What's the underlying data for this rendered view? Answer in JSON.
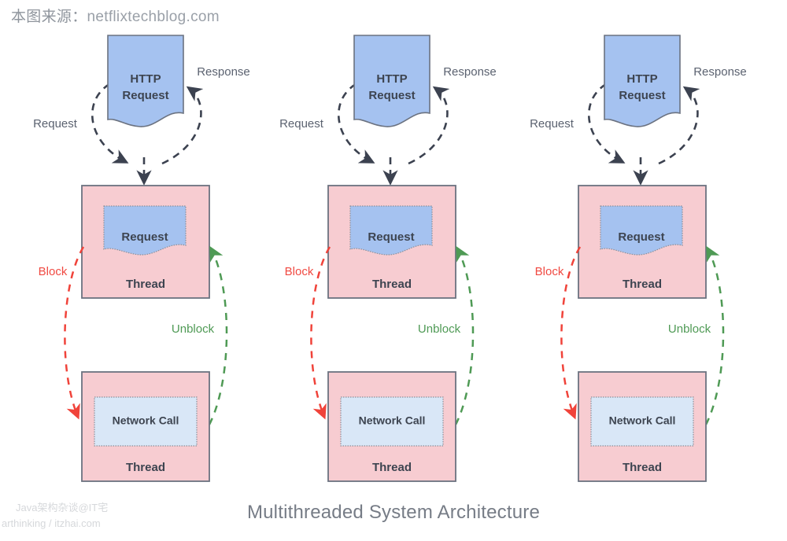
{
  "source_credit": {
    "label": "本图来源：",
    "url": "netflixtechblog.com"
  },
  "diagram": {
    "title": "Multithreaded System Architecture",
    "type": "architecture-flow",
    "column_count": 3,
    "colors": {
      "http_request_fill": "#a5c2f0",
      "thread_fill": "#f7ccd1",
      "request_fill": "#a5c2f0",
      "network_call_fill": "#d9e7f7",
      "shape_stroke": "#6b7280",
      "text": "#3d4450",
      "edge_label": "#5b6270",
      "block": "#f04a42",
      "unblock": "#4f9a55",
      "arrow": "#3c4250",
      "title": "#767c86",
      "watermark": "#d6d8db",
      "credit": "#9aa0a8"
    },
    "columns": [
      {
        "id": "column-1",
        "http_request_label_line1": "HTTP",
        "http_request_label_line2": "Request",
        "request_in_label": "Request",
        "response_out_label": "Response",
        "thread_top_label": "Thread",
        "request_box_label": "Request",
        "block_label": "Block",
        "unblock_label": "Unblock",
        "thread_bottom_label": "Thread",
        "network_call_label": "Network Call"
      },
      {
        "id": "column-2",
        "http_request_label_line1": "HTTP",
        "http_request_label_line2": "Request",
        "request_in_label": "Request",
        "response_out_label": "Response",
        "thread_top_label": "Thread",
        "request_box_label": "Request",
        "block_label": "Block",
        "unblock_label": "Unblock",
        "thread_bottom_label": "Thread",
        "network_call_label": "Network Call"
      },
      {
        "id": "column-3",
        "http_request_label_line1": "HTTP",
        "http_request_label_line2": "Request",
        "request_in_label": "Request",
        "response_out_label": "Response",
        "thread_top_label": "Thread",
        "request_box_label": "Request",
        "block_label": "Block",
        "unblock_label": "Unblock",
        "thread_bottom_label": "Thread",
        "network_call_label": "Network Call"
      }
    ]
  },
  "watermark": {
    "line1": "Java架构杂谈@IT宅",
    "line2": "arthinking / itzhai.com"
  }
}
